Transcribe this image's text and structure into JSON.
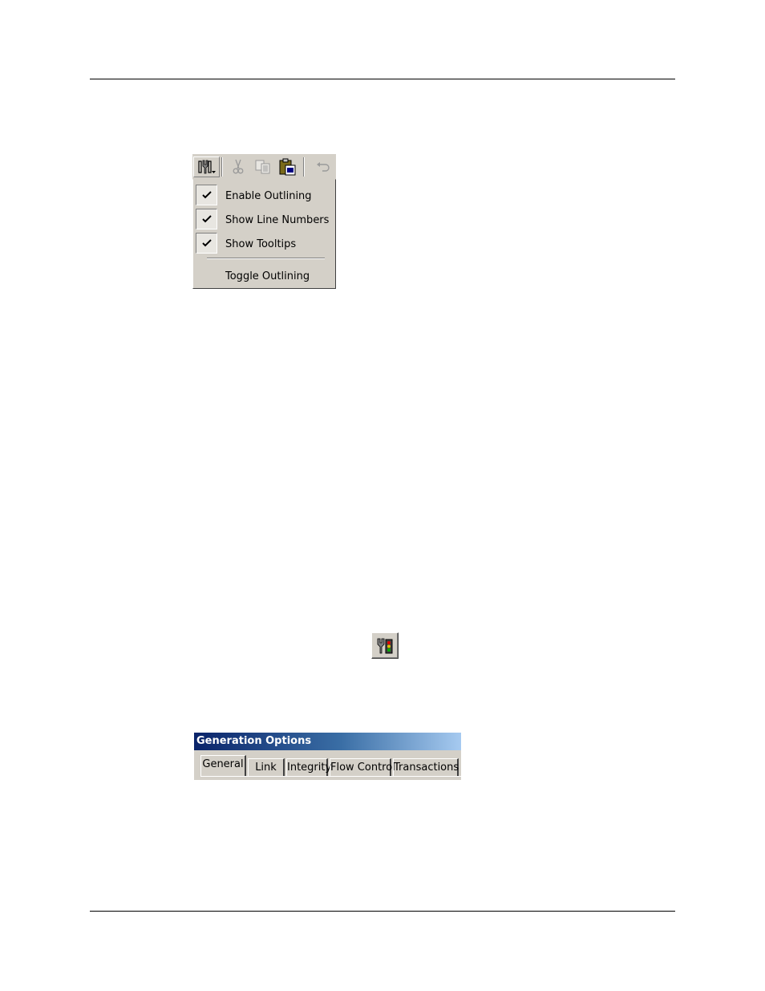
{
  "toolbar": {
    "buttons": [
      {
        "icon": "options-icon"
      },
      {
        "icon": "cut-icon"
      },
      {
        "icon": "copy-icon"
      },
      {
        "icon": "paste-icon"
      },
      {
        "icon": "undo-icon"
      }
    ]
  },
  "menu": {
    "items": [
      {
        "label": "Enable Outlining",
        "checked": true
      },
      {
        "label": "Show Line Numbers",
        "checked": true
      },
      {
        "label": "Show Tooltips",
        "checked": true
      },
      {
        "label": "Toggle Outlining",
        "checked": false
      }
    ]
  },
  "options_icon": {
    "icon": "options-traffic-light-icon"
  },
  "generation_options": {
    "title": "Generation Options",
    "tabs": [
      {
        "label": "General",
        "active": true
      },
      {
        "label": "Link",
        "active": false
      },
      {
        "label": "Integrity",
        "active": false
      },
      {
        "label": "Flow Control",
        "active": false
      },
      {
        "label": "Transactions",
        "active": false
      }
    ]
  },
  "colors": {
    "face": "#d4d0c8",
    "titlebar_start": "#0a246a",
    "titlebar_end": "#a6caf0"
  }
}
